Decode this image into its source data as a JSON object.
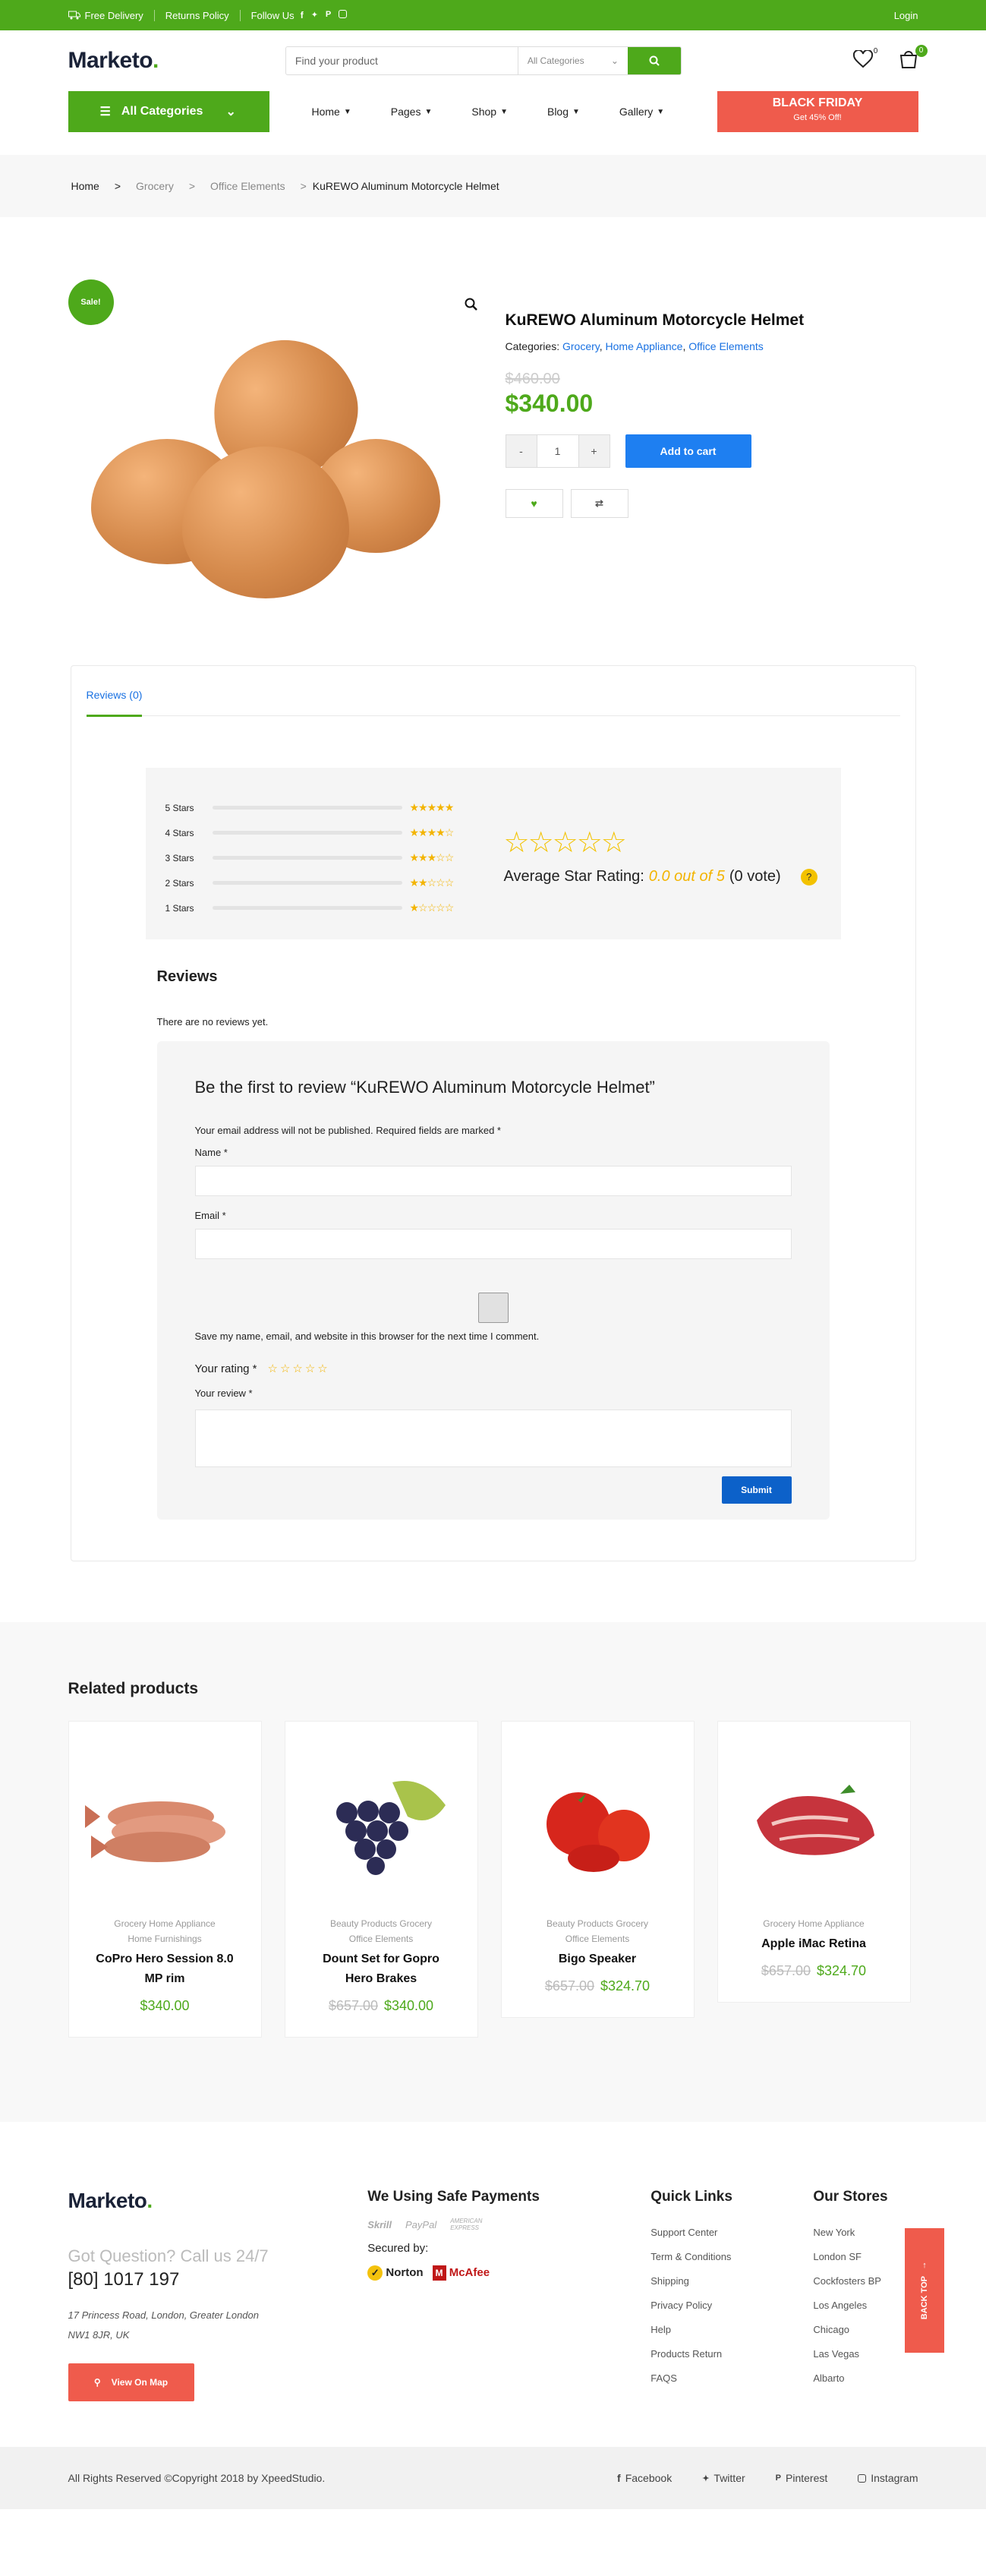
{
  "topbar": {
    "free_delivery": "Free Delivery",
    "returns_policy": "Returns Policy",
    "follow_us": "Follow Us",
    "login": "Login"
  },
  "header": {
    "logo": "Marketo",
    "logo_dot": ".",
    "search_placeholder": "Find your product",
    "category_select": "All Categories",
    "wishlist_count": "0",
    "cart_count": "0"
  },
  "nav": {
    "all_categories": "All Categories",
    "items": [
      "Home",
      "Pages",
      "Shop",
      "Blog",
      "Gallery"
    ],
    "promo_title": "BLACK FRIDAY",
    "promo_sub": "Get 45% Off!"
  },
  "breadcrumb": [
    "Home",
    "Grocery",
    "Office Elements",
    "KuREWO Aluminum Motorcycle Helmet"
  ],
  "product": {
    "sale": "Sale!",
    "title": "KuREWO Aluminum Motorcycle Helmet",
    "categories_label": "Categories: ",
    "categories": [
      "Grocery",
      "Home Appliance",
      "Office Elements"
    ],
    "old_price": "$460.00",
    "price": "$340.00",
    "qty": "1",
    "minus": "-",
    "plus": "+",
    "add_to_cart": "Add to cart"
  },
  "reviews_tab": {
    "tab": "Reviews (0)",
    "bars": [
      "5 Stars",
      "4 Stars",
      "3 Stars",
      "2 Stars",
      "1 Stars"
    ],
    "avg_label": "Average Star Rating:",
    "avg_value": "0.0 out of 5",
    "votes": "(0 vote)",
    "help": "?"
  },
  "reviews": {
    "heading": "Reviews",
    "none": "There are no reviews yet.",
    "form_title": "Be the first to review “KuREWO Aluminum Motorcycle Helmet”",
    "note": "Your email address will not be published. Required fields are marked *",
    "name_label": "Name *",
    "email_label": "Email *",
    "save_label": "Save my name, email, and website in this browser for the next time I comment.",
    "rating_label": "Your rating *",
    "review_label": "Your review *",
    "submit": "Submit"
  },
  "related": {
    "heading": "Related products",
    "cards": [
      {
        "cats": "Grocery Home Appliance",
        "cats2": "Home Furnishings",
        "name": "CoPro Hero Session 8.0",
        "name2": "MP rim",
        "old": "",
        "price": "$340.00"
      },
      {
        "cats": "Beauty Products Grocery",
        "cats2": "Office Elements",
        "name": "Dount Set for Gopro",
        "name2": "Hero Brakes",
        "old": "$657.00",
        "price": "$340.00"
      },
      {
        "cats": "Beauty Products Grocery",
        "cats2": "Office Elements",
        "name": "Bigo Speaker",
        "name2": "",
        "old": "$657.00",
        "price": "$324.70"
      },
      {
        "cats": "Grocery Home Appliance",
        "cats2": "",
        "name": "Apple iMac Retina",
        "name2": "",
        "old": "$657.00",
        "price": "$324.70"
      }
    ]
  },
  "footer": {
    "logo": "Marketo",
    "question": "Got Question? Call us 24/7",
    "phone": "[80] 1017 197",
    "address1": "17 Princess Road, London, Greater London",
    "address2": "NW1 8JR, UK",
    "map_button": "View On Map",
    "payments_title": "We Using Safe Payments",
    "payments": [
      "Skrill",
      "PayPal",
      "AMERICAN EXPRESS"
    ],
    "secured_by": "Secured by:",
    "norton": "Norton",
    "mcafee": "McAfee",
    "quick_links_title": "Quick Links",
    "quick_links": [
      "Support Center",
      "Term & Conditions",
      "Shipping",
      "Privacy Policy",
      "Help",
      "Products Return",
      "FAQS"
    ],
    "stores_title": "Our Stores",
    "stores": [
      "New York",
      "London SF",
      "Cockfosters BP",
      "Los Angeles",
      "Chicago",
      "Las Vegas",
      "Albarto"
    ],
    "back_top": "BACK TOP",
    "copyright": "All Rights Reserved ©Copyright 2018 by XpeedStudio.",
    "social": [
      "Facebook",
      "Twitter",
      "Pinterest",
      "Instagram"
    ]
  },
  "colors": {
    "green": "#4ea91b",
    "blue": "#1e7ff1",
    "red": "#ef5b4c",
    "star": "#f3b400"
  }
}
